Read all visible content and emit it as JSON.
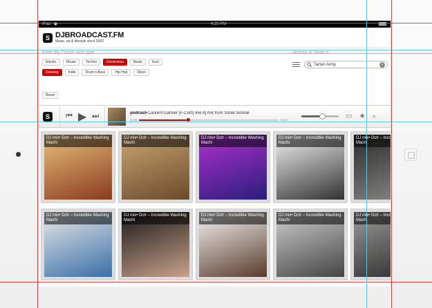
{
  "status": {
    "carrier": "iPad",
    "time": "4:20 PM",
    "battery": "▮"
  },
  "brand": {
    "logo": "S",
    "name": "DJBROADCAST.FM",
    "tagline": "Music, art & lifestyle since 2002"
  },
  "filters": {
    "title": "Filter By Genre and type",
    "genres_row1": [
      "Electro",
      "House",
      "Techno",
      "Electronica",
      "Beats",
      "Soul"
    ],
    "genres_row2": [
      "Dubstep",
      "Indie",
      "Drum n Bass",
      "Hip Hop",
      "Disco"
    ],
    "active_row1": "Electronica",
    "active_row2": "Dubstep",
    "reset_label": "Reset"
  },
  "history": {
    "title": "History & Search",
    "search_value": "Tartan Army",
    "clear": "×"
  },
  "player": {
    "logo": "S",
    "prev": "⏮",
    "play": "▶",
    "next": "⏭",
    "title_bold": "podcast•",
    "title_rest": " Laurent Garnier (F-Com) live dj mix from Sonar festival",
    "elapsed": "02:45",
    "total": "33:42",
    "progress": 0.35,
    "volume": 0.55,
    "airplay": "▭",
    "star": "★",
    "search": "⌕",
    "accent": "#cc0000"
  },
  "cards": [
    {
      "caption": "DJ mix• Dctr – Incredible Washing Machi",
      "colors": [
        "#e6c07a",
        "#8b3a1f"
      ]
    },
    {
      "caption": "DJ mix• Dctr – Incredible Washing Machi",
      "colors": [
        "#c9a572",
        "#6b4a2b"
      ]
    },
    {
      "caption": "DJ mix• Dctr – Incredible Washing Machi",
      "colors": [
        "#b02fd0",
        "#2a1e7a"
      ]
    },
    {
      "caption": "DJ mix• Dctr – Incredible Washing Machi",
      "colors": [
        "#f2f2f2",
        "#333333"
      ]
    },
    {
      "caption": "DJ mix• Dctr – Incredible Washing Machi",
      "colors": [
        "#2b2b2b",
        "#8a8a8a"
      ]
    },
    {
      "caption": "DJ mix• Dctr – Incredible Washing Machi",
      "colors": [
        "#e8e8e8",
        "#3a6fa8"
      ]
    },
    {
      "caption": "DJ mix• Dctr – Incredible Washing Machi",
      "colors": [
        "#1a1a1a",
        "#c9a08a"
      ]
    },
    {
      "caption": "DJ mix• Dctr – Incredible Washing Machi",
      "colors": [
        "#f5f5f5",
        "#5a3b2b"
      ]
    },
    {
      "caption": "DJ mix• Dctr – Incredible Washing Machi",
      "colors": [
        "#cfcfcf",
        "#444444"
      ]
    },
    {
      "caption": "DJ mix• Dctr – Incredible Washing Machi",
      "colors": [
        "#9a9a9a",
        "#2b2b2b"
      ]
    }
  ]
}
